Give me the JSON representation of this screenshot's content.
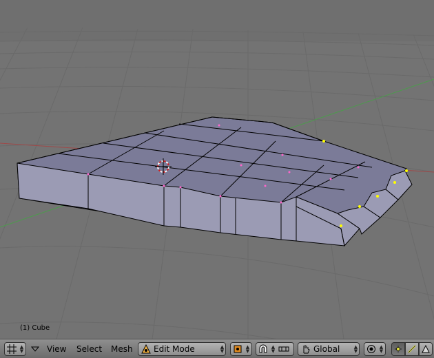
{
  "viewport": {
    "object_label": "(1) Cube"
  },
  "header": {
    "editor_type_icon": "grid-icon",
    "menu_toggle_icon": "triangle-down-icon",
    "menus": [
      "View",
      "Select",
      "Mesh"
    ],
    "mode": {
      "label": "Edit Mode",
      "icon": "edit-mode-triangle-icon"
    },
    "pivot_icon": "pivot-point-icon",
    "snap_icon": "magnet-icon",
    "snap_target_icon": "snap-element-icon",
    "transform_icon": "hand-icon",
    "orientation": "Global",
    "proportional_icon": "proportional-edit-icon",
    "select_modes": [
      {
        "name": "vertex-select",
        "icon": "vertex-icon",
        "active": true
      },
      {
        "name": "edge-select",
        "icon": "edge-icon",
        "active": false
      },
      {
        "name": "face-select",
        "icon": "face-icon",
        "active": false
      }
    ]
  },
  "colors": {
    "viewport_bg": "#737373",
    "grid_line": "#666666",
    "mesh_face": "#9b9bb4",
    "mesh_top": "#7b7b98",
    "mesh_edge": "#000000",
    "selected_vertex": "#ffff00",
    "vertex_pink": "#ff66cc",
    "x_axis": "#a04848",
    "y_axis": "#4c9c4c",
    "header_bg": "#737373"
  }
}
